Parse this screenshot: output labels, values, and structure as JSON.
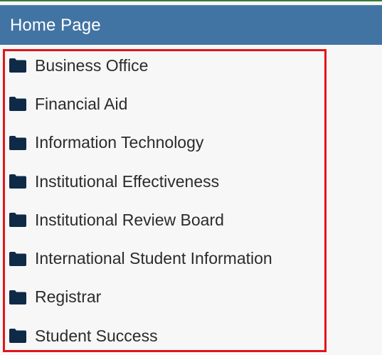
{
  "header": {
    "title": "Home Page"
  },
  "folders": [
    {
      "label": "Business Office",
      "icon": "folder-icon"
    },
    {
      "label": "Financial Aid",
      "icon": "folder-icon"
    },
    {
      "label": "Information Technology",
      "icon": "folder-icon"
    },
    {
      "label": "Institutional Effectiveness",
      "icon": "folder-icon"
    },
    {
      "label": "Institutional Review Board",
      "icon": "folder-icon"
    },
    {
      "label": "International Student Information",
      "icon": "folder-icon"
    },
    {
      "label": "Registrar",
      "icon": "folder-icon"
    },
    {
      "label": "Student Success",
      "icon": "folder-icon"
    }
  ],
  "colors": {
    "header_bg": "#4274a3",
    "header_text": "#ffffff",
    "highlight_border": "#e3141b",
    "folder_icon": "#0e2a47",
    "text": "#2b2b2b"
  }
}
